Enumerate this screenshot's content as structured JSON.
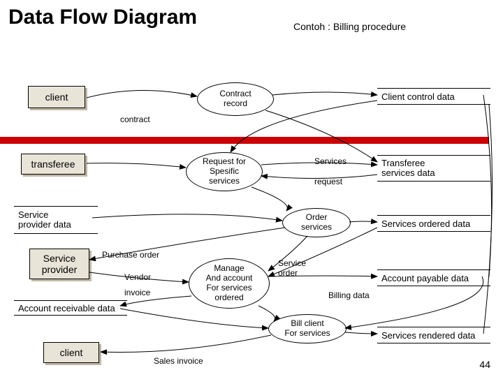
{
  "title": "Data Flow Diagram",
  "subtitle": "Contoh : Billing procedure",
  "entities": {
    "client_top": "client",
    "transferee": "transferee",
    "service_provider": "Service\nprovider",
    "client_bottom": "client"
  },
  "processes": {
    "contract_record": "Contract\nrecord",
    "request_services": "Request for\nSpesific\nservices",
    "order_services": "Order\nservices",
    "manage_account": "Manage\nAnd account\nFor services\nordered",
    "bill_client": "Bill client\nFor services"
  },
  "datastores": {
    "left_sp_data": "Service\nprovider data",
    "left_ar_data": "Account receivable data",
    "client_control": "Client control data",
    "transferee_services": "Transferee\nservices data",
    "services_ordered": "Services ordered data",
    "account_payable": "Account payable data",
    "services_rendered": "Services rendered data"
  },
  "labels": {
    "contract": "contract",
    "services": "Services",
    "request": "request",
    "purchase_order": "Purchase order",
    "vendor": "Vendor",
    "invoice": "invoice",
    "service_order": "Service\norder",
    "billing_data": "Billing data",
    "sales_invoice": "Sales invoice"
  },
  "page": "44"
}
